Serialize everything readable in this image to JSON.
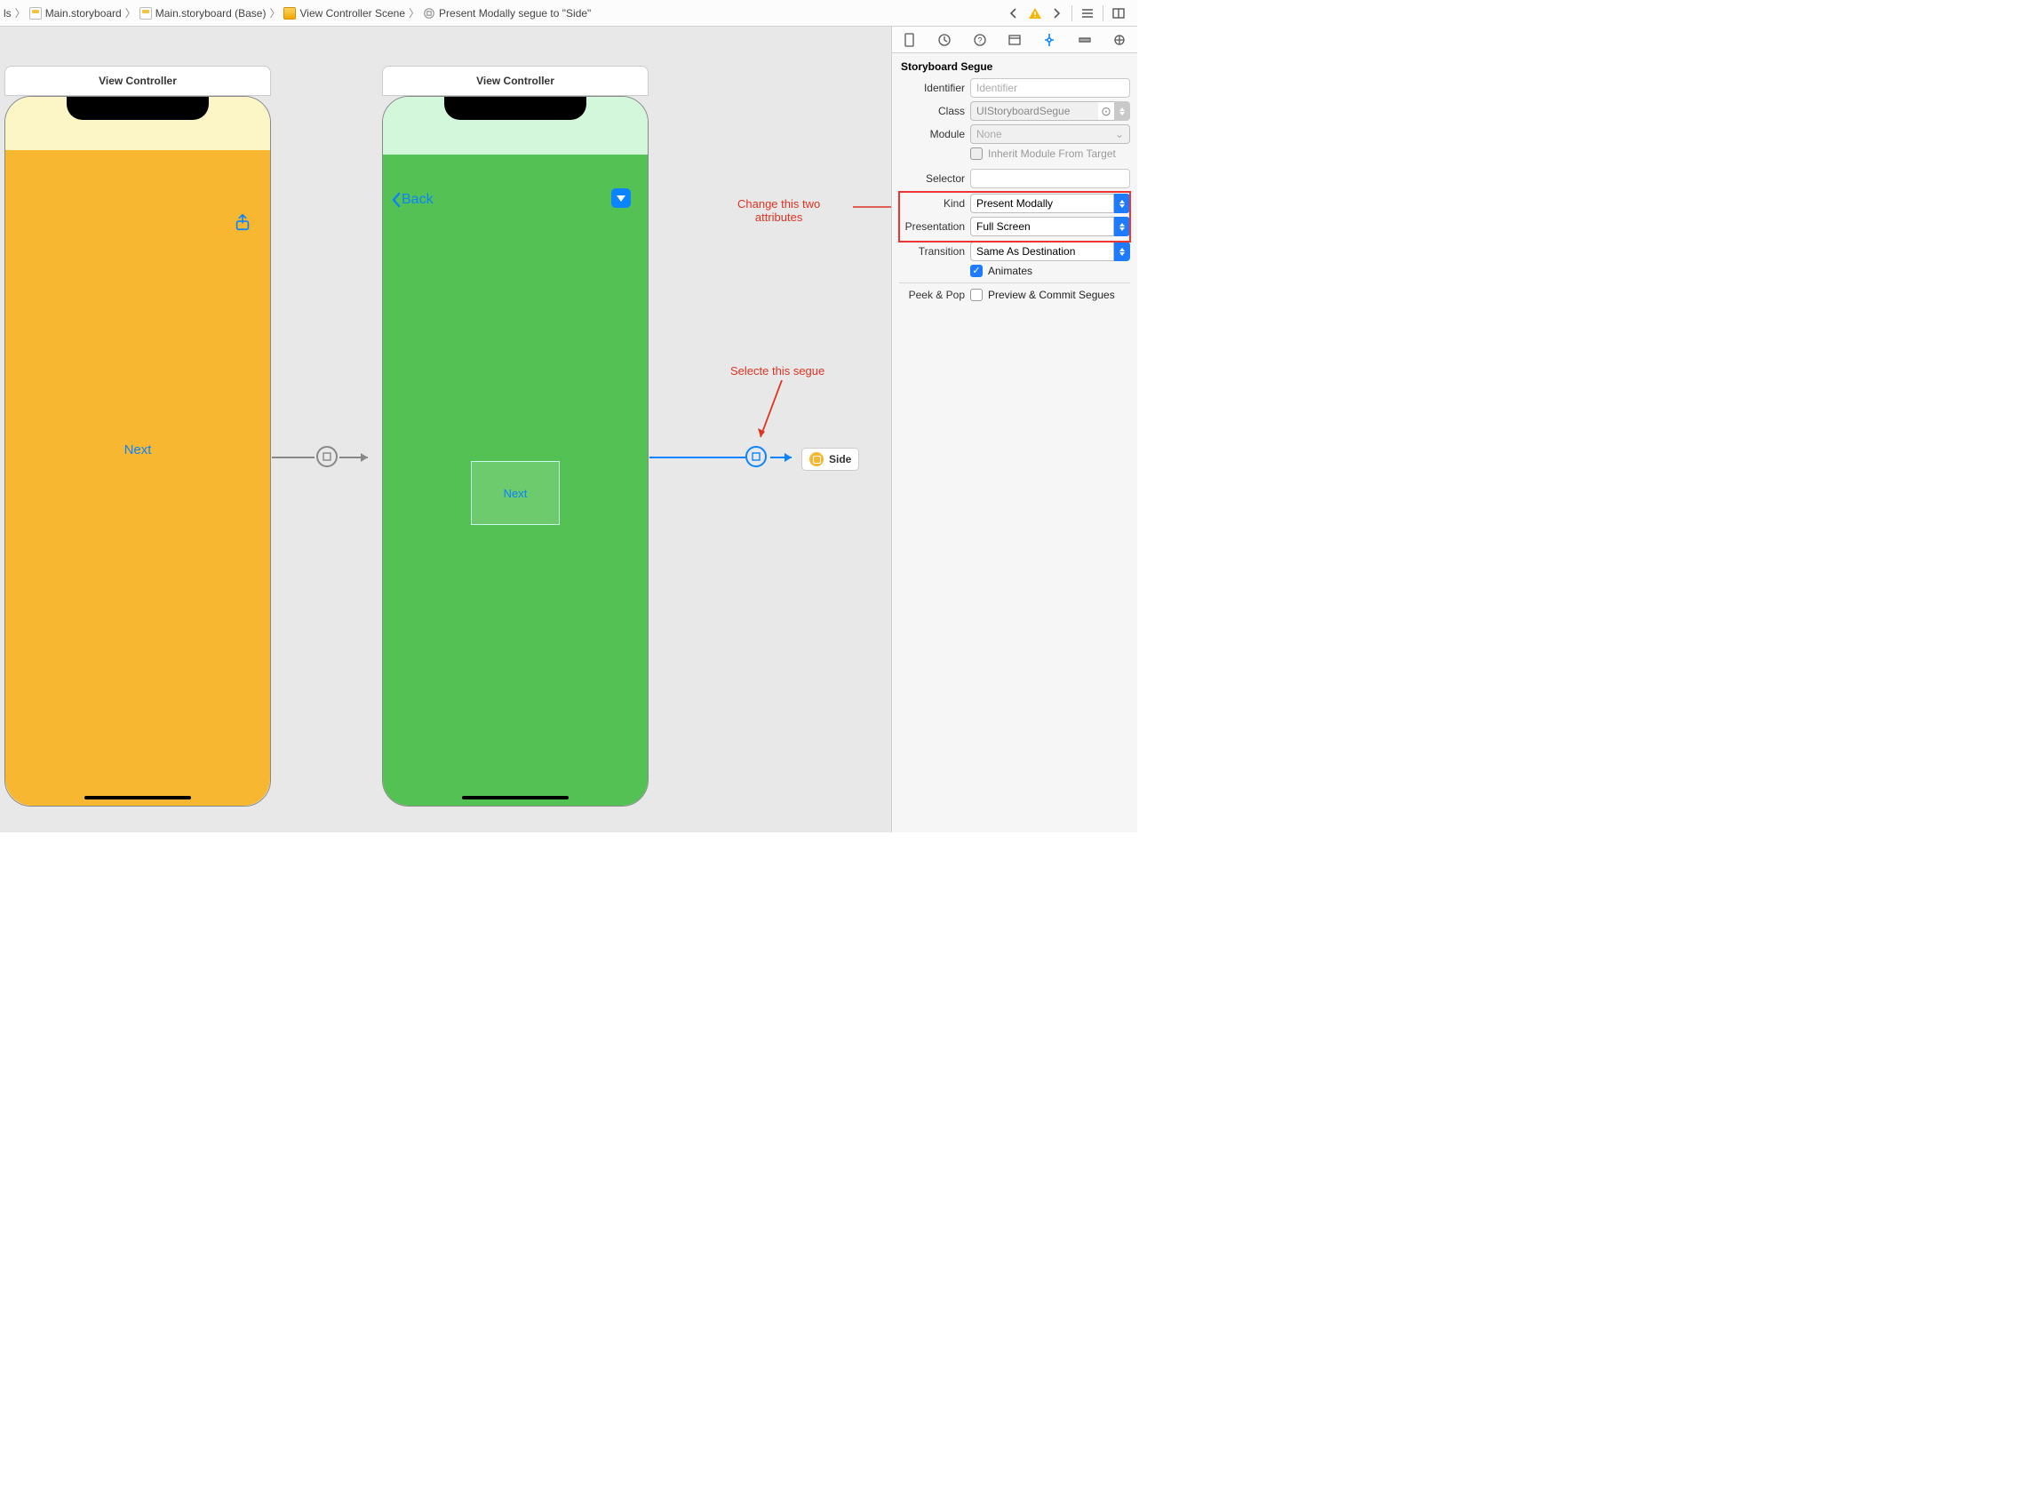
{
  "breadcrumb": {
    "item0": "ls",
    "item1": "Main.storyboard",
    "item2": "Main.storyboard (Base)",
    "item3": "View Controller Scene",
    "item4": "Present Modally segue to \"Side\""
  },
  "canvas": {
    "vc1_title": "View Controller",
    "vc2_title": "View Controller",
    "next_label": "Next",
    "back_label": "Back",
    "container_label": "Next",
    "side_label": "Side"
  },
  "annotations": {
    "attrs_text_line1": "Change this two",
    "attrs_text_line2": "attributes",
    "segue_text": "Selecte this segue"
  },
  "inspector": {
    "section_title": "Storyboard Segue",
    "identifier_label": "Identifier",
    "identifier_placeholder": "Identifier",
    "class_label": "Class",
    "class_value": "UIStoryboardSegue",
    "module_label": "Module",
    "module_value": "None",
    "inherit_label": "Inherit Module From Target",
    "selector_label": "Selector",
    "selector_value": "",
    "kind_label": "Kind",
    "kind_value": "Present Modally",
    "presentation_label": "Presentation",
    "presentation_value": "Full Screen",
    "transition_label": "Transition",
    "transition_value": "Same As Destination",
    "animates_label": "Animates",
    "peekpop_label": "Peek & Pop",
    "peekpop_value": "Preview & Commit Segues"
  }
}
